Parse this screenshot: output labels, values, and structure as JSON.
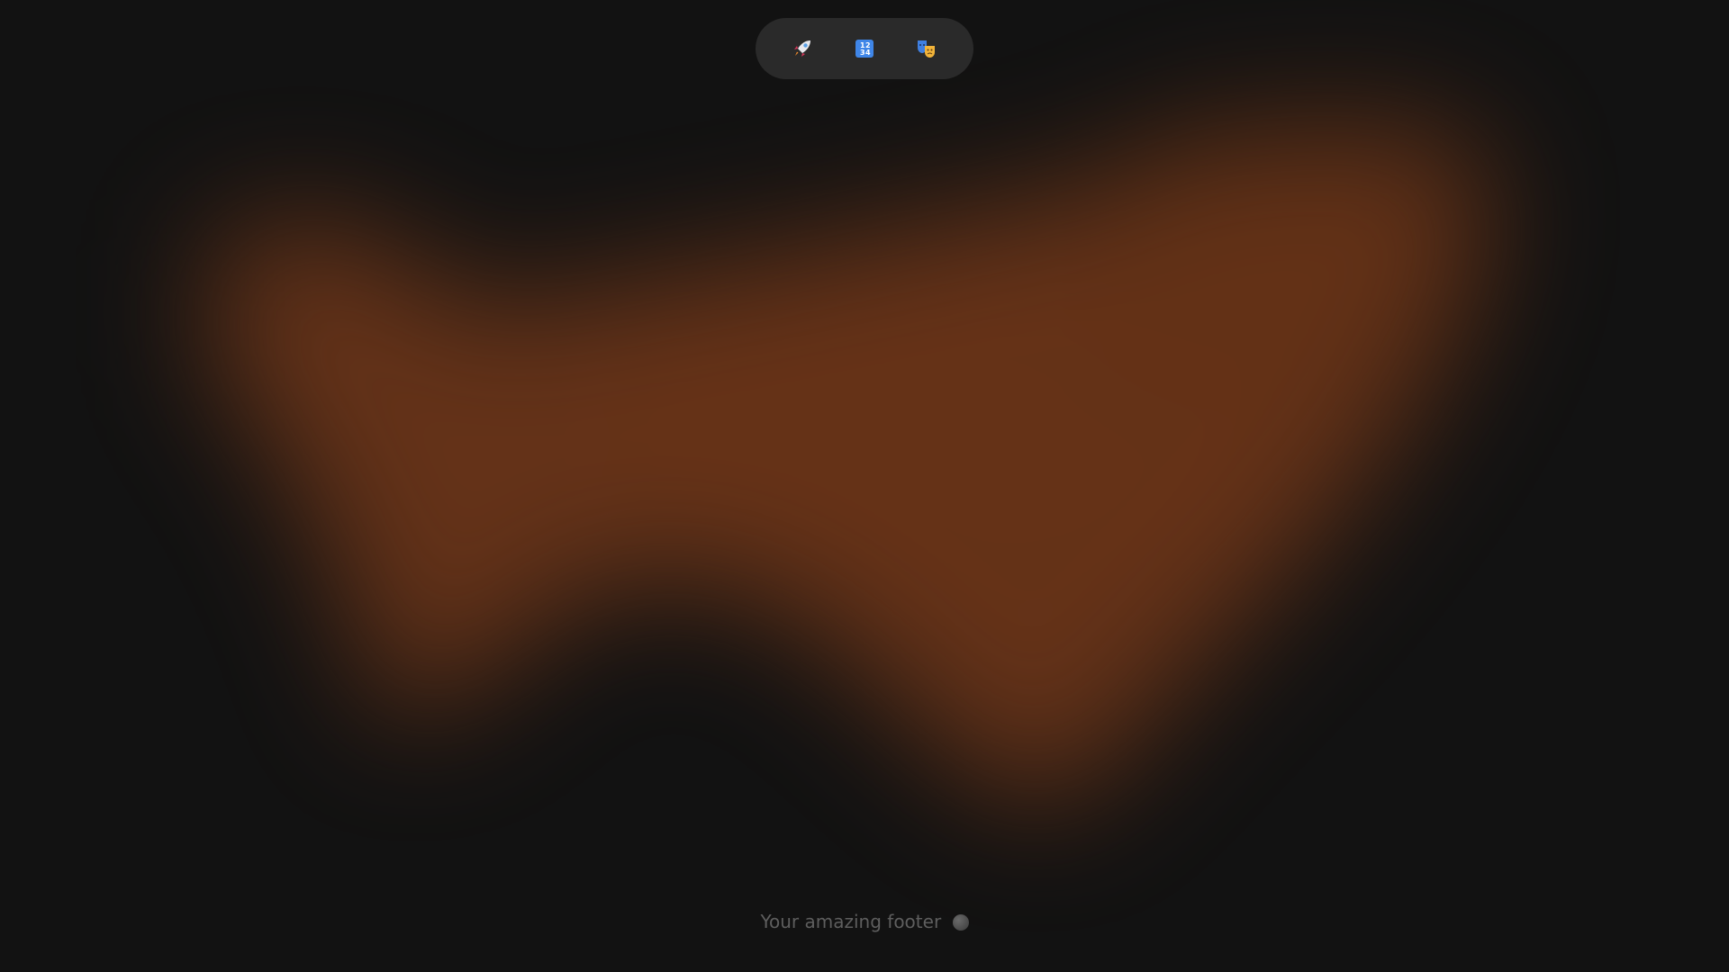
{
  "background_color": "#121212",
  "glow_color": "#6b3519",
  "nav": {
    "items": [
      {
        "icon": "rocket-icon",
        "label": ""
      },
      {
        "icon": "input-numbers-icon",
        "label": ""
      },
      {
        "icon": "performing-arts-icon",
        "label": ""
      }
    ],
    "background": "#2a2a2a"
  },
  "footer": {
    "text": "Your amazing footer",
    "icon": "globe-icon",
    "color": "#5e5e5e"
  }
}
